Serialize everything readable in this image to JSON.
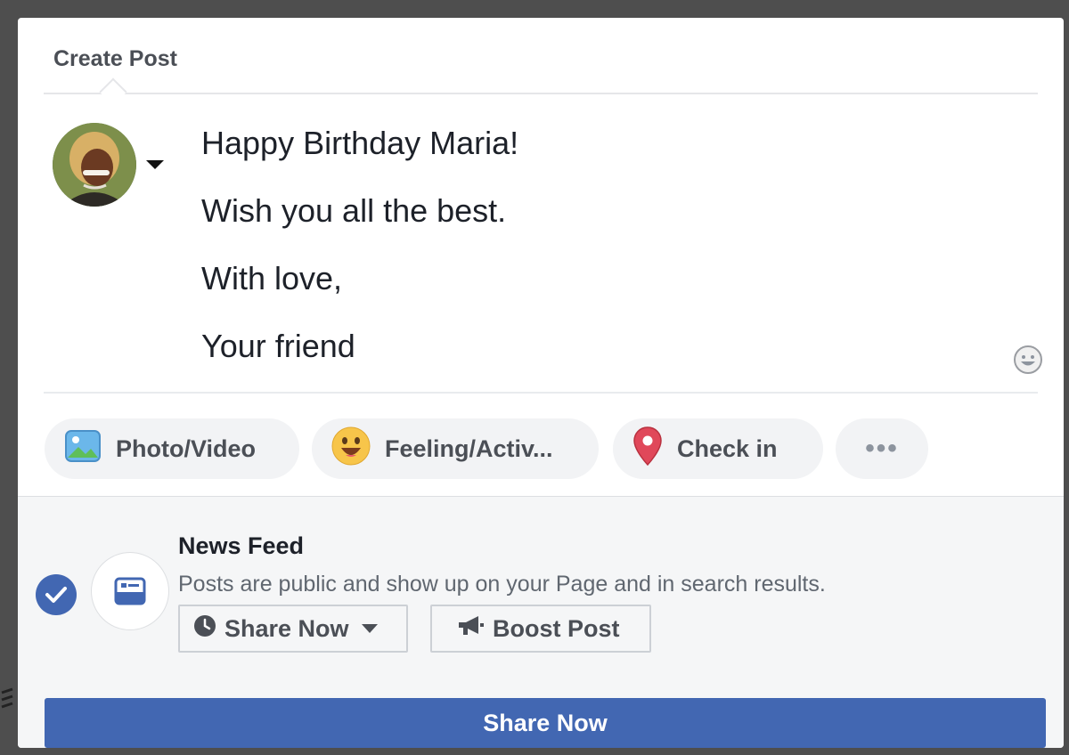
{
  "header": {
    "title": "Create Post"
  },
  "composer": {
    "lines": [
      "Happy Birthday Maria!",
      "Wish you all the best.",
      "With love,",
      "Your friend"
    ]
  },
  "actions": {
    "photo_label": "Photo/Video",
    "feeling_label": "Feeling/Activ...",
    "checkin_label": "Check in",
    "more_label": "•••"
  },
  "audience": {
    "title": "News Feed",
    "description": "Posts are public and show up on your Page and in search results.",
    "share_dropdown_label": "Share Now",
    "boost_label": "Boost Post"
  },
  "footer": {
    "share_button_label": "Share Now"
  },
  "colors": {
    "brand": "#4267b2",
    "page_bg": "#f5f6f7",
    "text": "#1d2129"
  },
  "icons": [
    "chevron-down-icon",
    "smiley-icon",
    "photo-icon",
    "feeling-emoji-icon",
    "location-pin-icon",
    "more-dots-icon",
    "checkmark-icon",
    "news-feed-icon",
    "clock-icon",
    "megaphone-icon"
  ]
}
